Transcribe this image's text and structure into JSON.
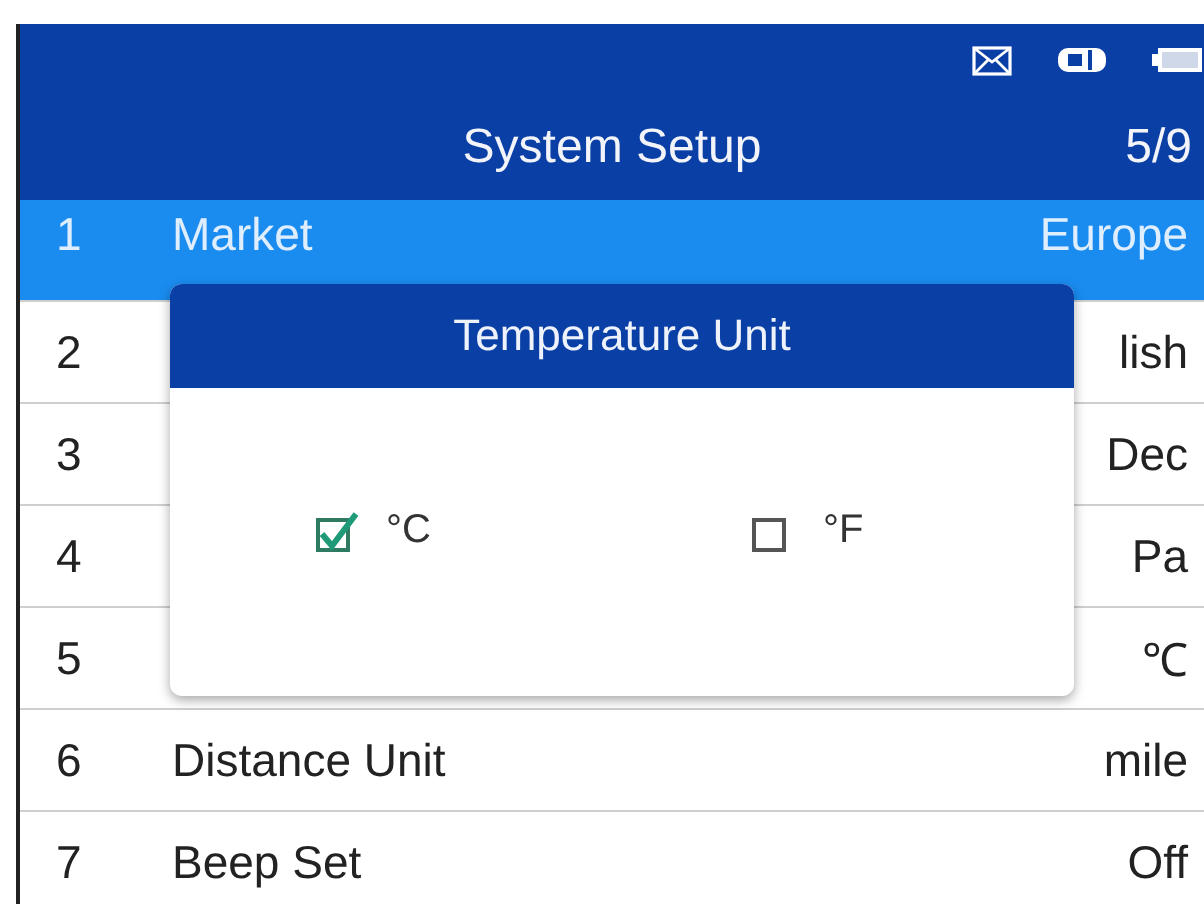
{
  "header": {
    "title": "System Setup",
    "page": "5/9"
  },
  "rows": [
    {
      "number": "1",
      "label": "Market",
      "value": "Europe",
      "selected": true
    },
    {
      "number": "2",
      "value": "lish",
      "selected": false
    },
    {
      "number": "3",
      "value": "Dec",
      "selected": false
    },
    {
      "number": "4",
      "value": "Pa",
      "selected": false
    },
    {
      "number": "5",
      "value": "℃",
      "selected": false
    },
    {
      "number": "6",
      "label": "Distance Unit",
      "value": "mile",
      "selected": false
    },
    {
      "number": "7",
      "label": "Beep Set",
      "value": "Off",
      "selected": false
    }
  ],
  "dialog": {
    "title": "Temperature Unit",
    "options": [
      {
        "label": "°C",
        "checked": true
      },
      {
        "label": "°F",
        "checked": false
      }
    ]
  }
}
